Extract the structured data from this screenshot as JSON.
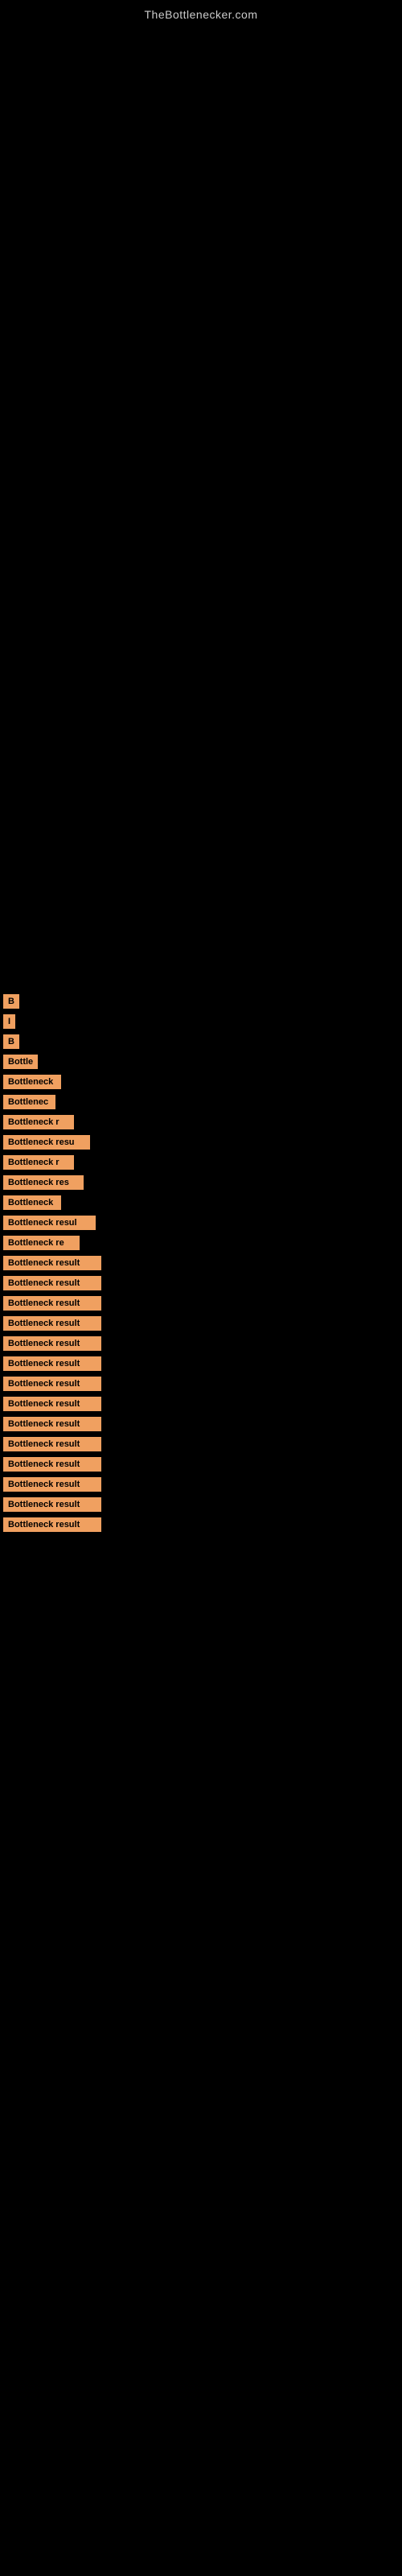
{
  "site": {
    "title": "TheBottlenecker.com"
  },
  "results": [
    {
      "id": 1,
      "label": "B",
      "width": 14
    },
    {
      "id": 2,
      "label": "I",
      "width": 14
    },
    {
      "id": 3,
      "label": "B",
      "width": 14
    },
    {
      "id": 4,
      "label": "Bottle",
      "width": 42
    },
    {
      "id": 5,
      "label": "Bottleneck",
      "width": 72
    },
    {
      "id": 6,
      "label": "Bottlenec",
      "width": 65
    },
    {
      "id": 7,
      "label": "Bottleneck r",
      "width": 88
    },
    {
      "id": 8,
      "label": "Bottleneck resu",
      "width": 108
    },
    {
      "id": 9,
      "label": "Bottleneck r",
      "width": 88
    },
    {
      "id": 10,
      "label": "Bottleneck res",
      "width": 100
    },
    {
      "id": 11,
      "label": "Bottleneck",
      "width": 72
    },
    {
      "id": 12,
      "label": "Bottleneck resul",
      "width": 115
    },
    {
      "id": 13,
      "label": "Bottleneck re",
      "width": 95
    },
    {
      "id": 14,
      "label": "Bottleneck result",
      "width": 122
    },
    {
      "id": 15,
      "label": "Bottleneck result",
      "width": 122
    },
    {
      "id": 16,
      "label": "Bottleneck result",
      "width": 122
    },
    {
      "id": 17,
      "label": "Bottleneck result",
      "width": 122
    },
    {
      "id": 18,
      "label": "Bottleneck result",
      "width": 122
    },
    {
      "id": 19,
      "label": "Bottleneck result",
      "width": 122
    },
    {
      "id": 20,
      "label": "Bottleneck result",
      "width": 122
    },
    {
      "id": 21,
      "label": "Bottleneck result",
      "width": 122
    },
    {
      "id": 22,
      "label": "Bottleneck result",
      "width": 122
    },
    {
      "id": 23,
      "label": "Bottleneck result",
      "width": 122
    },
    {
      "id": 24,
      "label": "Bottleneck result",
      "width": 122
    },
    {
      "id": 25,
      "label": "Bottleneck result",
      "width": 122
    },
    {
      "id": 26,
      "label": "Bottleneck result",
      "width": 122
    },
    {
      "id": 27,
      "label": "Bottleneck result",
      "width": 122
    }
  ]
}
